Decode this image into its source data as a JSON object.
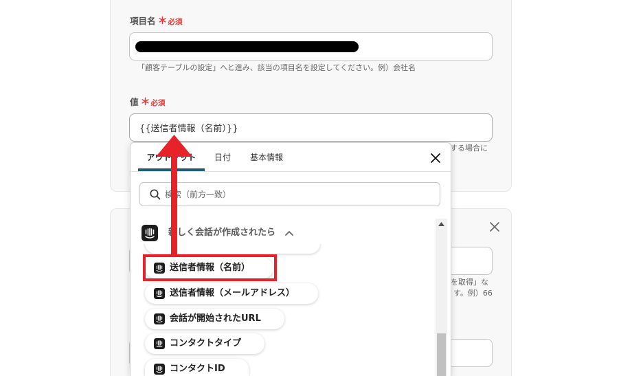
{
  "form": {
    "item_name_field": {
      "label": "項目名",
      "required_mark": "＊",
      "required_text": "必須",
      "help": "「顧客テーブルの設定」へと進み、該当の項目名を設定してください。例）会社名"
    },
    "value_field": {
      "label": "値",
      "required_mark": "＊",
      "required_text": "必須",
      "value": "{{送信者情報（名前）}}",
      "help_visible": "する場合に"
    }
  },
  "next_card": {
    "close_icon": "close-icon",
    "help_visible_line1": "を取得」な",
    "help_visible_line2": "す。例）66"
  },
  "dropdown": {
    "tabs": [
      {
        "label": "アウトプット",
        "active": true
      },
      {
        "label": "日付",
        "active": false
      },
      {
        "label": "基本情報",
        "active": false
      }
    ],
    "close_icon": "close-icon",
    "search": {
      "placeholder": "検索（前方一致）",
      "icon": "search-icon"
    },
    "group": {
      "label": "新しく会話が作成されたら",
      "icon": "intercom-icon",
      "toggle_icon": "chevron-up-icon",
      "expanded": true
    },
    "items": [
      {
        "label": "送信者情報（名前）",
        "icon": "intercom-icon",
        "highlighted": true
      },
      {
        "label": "送信者情報（メールアドレス）",
        "icon": "intercom-icon",
        "highlighted": false
      },
      {
        "label": "会話が開始されたURL",
        "icon": "intercom-icon",
        "highlighted": false
      },
      {
        "label": "コンタクトタイプ",
        "icon": "intercom-icon",
        "highlighted": false
      },
      {
        "label": "コンタクトID",
        "icon": "intercom-icon",
        "highlighted": false
      }
    ]
  },
  "colors": {
    "tab_accent": "#1f5c73",
    "required": "#e53935",
    "annotation_red": "#e6232a",
    "card_background": "#f8f8f8"
  }
}
